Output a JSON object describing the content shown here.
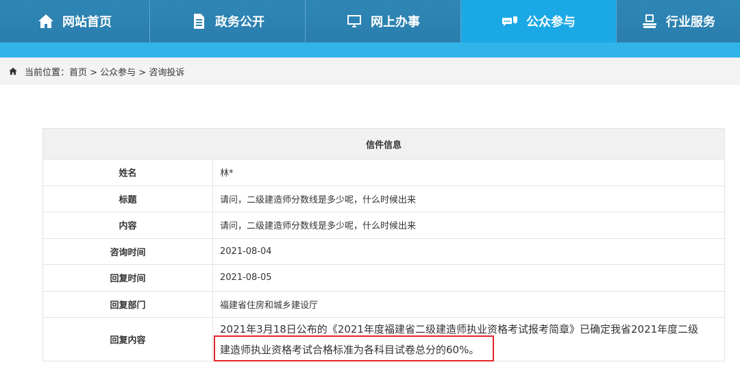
{
  "nav": {
    "items": [
      {
        "label": "网站首页",
        "icon": "home-icon"
      },
      {
        "label": "政务公开",
        "icon": "document-icon"
      },
      {
        "label": "网上办事",
        "icon": "monitor-icon"
      },
      {
        "label": "公众参与",
        "icon": "chat-icon",
        "active": true
      },
      {
        "label": "行业服务",
        "icon": "person-desk-icon"
      }
    ],
    "colors": {
      "bar": "#2a7ead",
      "active": "#1aa9e6",
      "stripe": "#31b4ea"
    }
  },
  "breadcrumb": {
    "text": "当前位置：首页 > 公众参与 > 咨询投诉"
  },
  "letter": {
    "header": "信件信息",
    "rows": [
      {
        "label": "姓名",
        "value": "林*"
      },
      {
        "label": "标题",
        "value": "请问，二级建造师分数线是多少呢，什么时候出来"
      },
      {
        "label": "内容",
        "value": "请问，二级建造师分数线是多少呢，什么时候出来"
      },
      {
        "label": "咨询时间",
        "value": "2021-08-04"
      },
      {
        "label": "回复时间",
        "value": "2021-08-05"
      },
      {
        "label": "回复部门",
        "value": "福建省住房和城乡建设厅"
      }
    ],
    "reply": {
      "label": "回复内容",
      "line1": "2021年3月18日公布的《2021年度福建省二级建造师执业资格考试报考简章》已确定我省2021年度二级",
      "line2": "建造师执业资格考试合格标准为各科目试卷总分的60%。"
    },
    "highlight_color": "#e2232a"
  }
}
